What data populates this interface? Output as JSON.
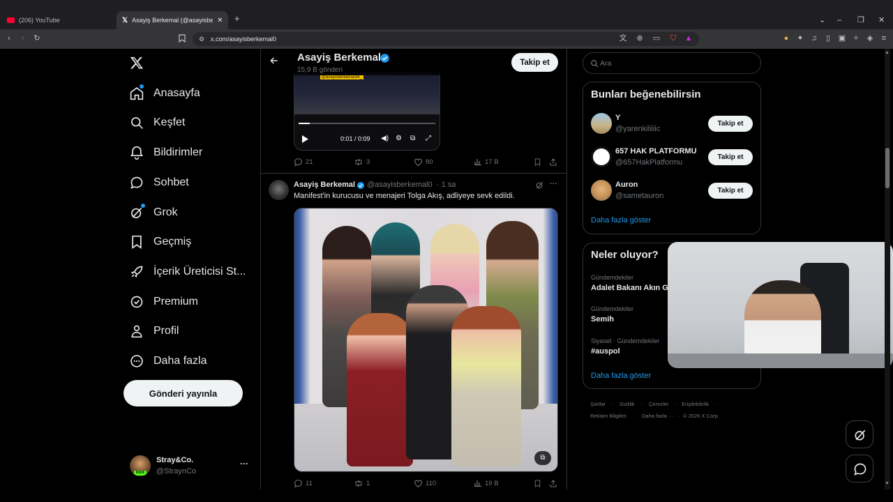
{
  "browser": {
    "tabs": [
      {
        "title": "(206) YouTube"
      },
      {
        "title": "Asayiş Berkemal (@asayisberken"
      }
    ],
    "new_tab": "+",
    "url": "x.com/asayisberkemal0"
  },
  "nav": {
    "items": [
      {
        "label": "Anasayfa"
      },
      {
        "label": "Keşfet"
      },
      {
        "label": "Bildirimler"
      },
      {
        "label": "Sohbet"
      },
      {
        "label": "Grok"
      },
      {
        "label": "Geçmiş"
      },
      {
        "label": "İçerik Üreticisi St..."
      },
      {
        "label": "Premium"
      },
      {
        "label": "Profil"
      },
      {
        "label": "Daha fazla"
      }
    ],
    "post_button": "Gönderi yayınla",
    "account": {
      "name": "Stray&Co.",
      "handle": "@StraynCo",
      "more": "···",
      "avatar_badge": "KICK"
    }
  },
  "profile_header": {
    "name": "Asayiş Berkemal",
    "posts": "15,9 B gönderi",
    "follow": "Takip et"
  },
  "tweet1": {
    "video_overlay": "@asayisberkemal34_",
    "time": "0:01 / 0:09",
    "replies": "21",
    "reposts": "3",
    "likes": "80",
    "views": "17 B"
  },
  "tweet2": {
    "name": "Asayiş Berkemal",
    "handle": "@asayisberkemal0",
    "time": "· 1 sa",
    "text": "Manifest'in kurucusu ve menajeri Tolga Akış, adliyeye sevk edildi.",
    "replies": "11",
    "reposts": "1",
    "likes": "110",
    "views": "19 B"
  },
  "search": {
    "placeholder": "Ara"
  },
  "suggestions": {
    "title": "Bunları beğenebilirsin",
    "follow": "Takip et",
    "items": [
      {
        "name": "Y",
        "handle": "@yarenkiliiiic"
      },
      {
        "name": "657 HAK PLATFORMU",
        "handle": "@657HakPlatformu"
      },
      {
        "name": "Auron",
        "handle": "@sametauron"
      }
    ],
    "more": "Daha fazla göster"
  },
  "trends": {
    "title": "Neler oluyor?",
    "items": [
      {
        "meta": "Gündemdekiler",
        "title": "Adalet Bakanı Akın G"
      },
      {
        "meta": "Gündemdekiler",
        "title": "Semih"
      },
      {
        "meta": "Siyaset · Gündemdekiler",
        "title": "#auspol"
      }
    ],
    "more": "Daha fazla göster"
  },
  "footer": {
    "links": [
      "Şartlar",
      "Gizlilik",
      "Çerezler",
      "Erişilebilirlik",
      "Reklam Bilgileri",
      "Daha fazla ···",
      "© 2026 X Corp."
    ]
  },
  "colors": {
    "accent": "#1d9bf0",
    "background": "#000000",
    "border": "#2f3336"
  }
}
